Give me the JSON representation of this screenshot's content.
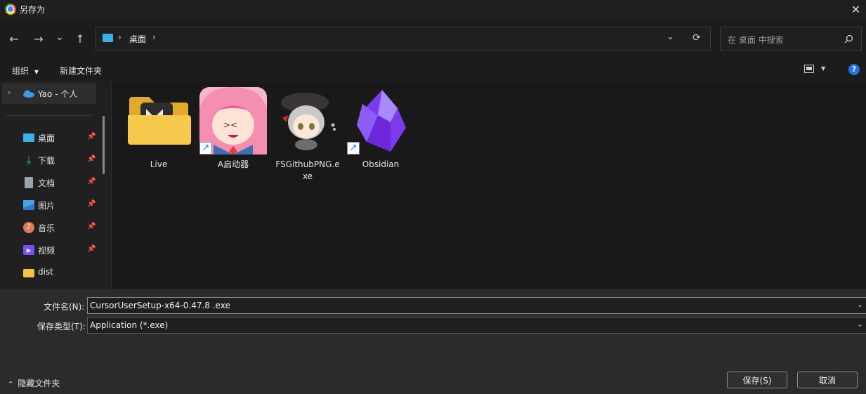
{
  "window": {
    "title": "另存为",
    "close_label": "✕"
  },
  "nav": {
    "back": "←",
    "forward": "→",
    "recent": "⌄",
    "up": "↑",
    "breadcrumb": [
      "桌面"
    ],
    "refresh": "⟳",
    "dropdown": "⌄"
  },
  "search": {
    "placeholder": "在 桌面 中搜索"
  },
  "toolbar": {
    "organize": "组织",
    "new_folder": "新建文件夹",
    "help": "?"
  },
  "sidebar": {
    "top_item": "Yao - 个人",
    "items": [
      {
        "label": "桌面",
        "icon": "desktop-icon",
        "pinned": true
      },
      {
        "label": "下载",
        "icon": "download-icon",
        "pinned": true
      },
      {
        "label": "文档",
        "icon": "document-icon",
        "pinned": true
      },
      {
        "label": "图片",
        "icon": "pictures-icon",
        "pinned": true
      },
      {
        "label": "音乐",
        "icon": "music-icon",
        "pinned": true
      },
      {
        "label": "视频",
        "icon": "video-icon",
        "pinned": true
      },
      {
        "label": "dist",
        "icon": "folder-icon",
        "pinned": false
      }
    ]
  },
  "files": [
    {
      "name": "Live",
      "type": "folder"
    },
    {
      "name": "A启动器",
      "type": "shortcut"
    },
    {
      "name": "FSGithubPNG.exe",
      "type": "exe"
    },
    {
      "name": "Obsidian",
      "type": "shortcut"
    }
  ],
  "form": {
    "filename_label": "文件名(N):",
    "filename_value": "CursorUserSetup-x64-0.47.8 .exe",
    "filetype_label": "保存类型(T):",
    "filetype_value": "Application (*.exe)"
  },
  "footer": {
    "hide_folders": "隐藏文件夹",
    "save": "保存(S)",
    "cancel": "取消"
  },
  "colors": {
    "accent": "#1a73e8",
    "folder": "#f4c542",
    "obsidian": "#8b5cf6"
  }
}
